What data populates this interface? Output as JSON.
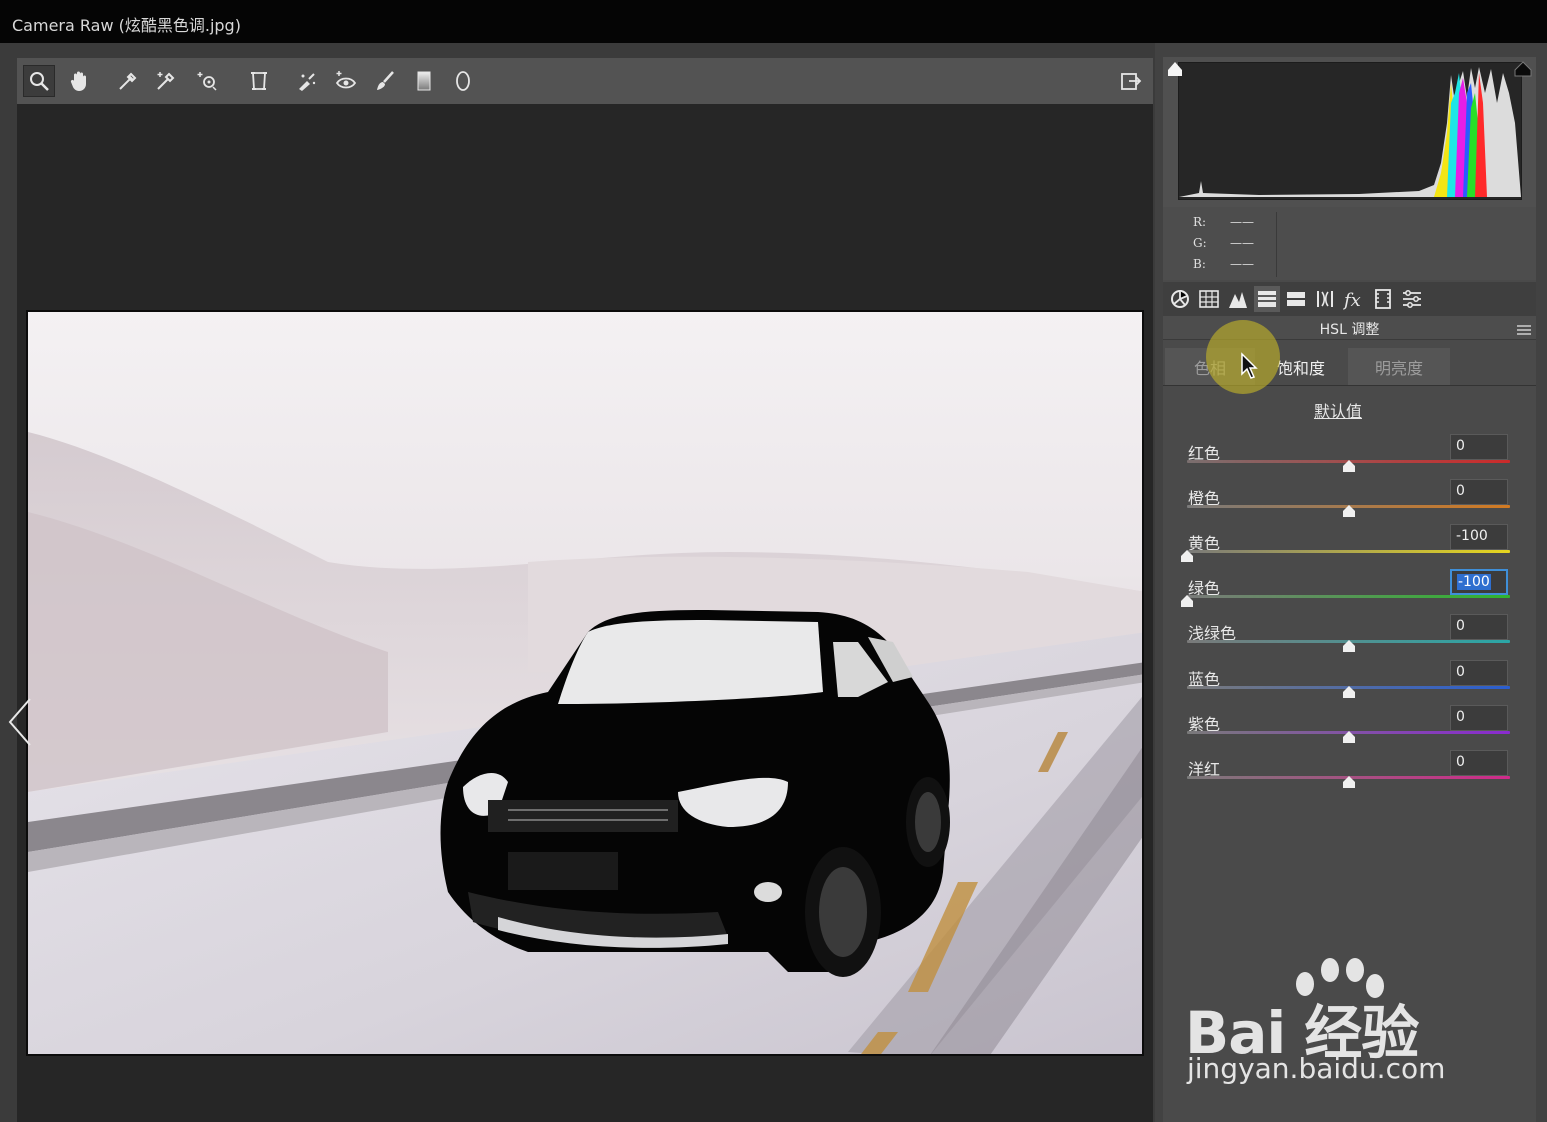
{
  "window": {
    "title": "Camera Raw (炫酷黑色调.jpg)"
  },
  "toolbar": {
    "tools": [
      "zoom-tool",
      "hand-tool",
      "white-balance-tool",
      "color-sampler-tool",
      "targeted-adjustment-tool",
      "transform-tool",
      "spot-removal-tool",
      "red-eye-tool",
      "adjustment-brush-tool",
      "graduated-filter-tool",
      "radial-filter-tool"
    ],
    "active_tool": "zoom-tool",
    "export_icon": "open-preferences-icon"
  },
  "histogram": {
    "rgb": [
      {
        "label": "R:",
        "value": "——"
      },
      {
        "label": "G:",
        "value": "——"
      },
      {
        "label": "B:",
        "value": "——"
      }
    ]
  },
  "panel_tabs": [
    "basic-icon",
    "tone-curve-icon",
    "detail-icon",
    "hsl-icon",
    "split-toning-icon",
    "lens-corrections-icon",
    "effects-icon",
    "camera-calibration-icon",
    "presets-icon"
  ],
  "hsl": {
    "section_title": "HSL 调整",
    "tabs": [
      "色相",
      "饱和度",
      "明亮度"
    ],
    "active_tab": "饱和度",
    "defaults_label": "默认值",
    "sliders": [
      {
        "label": "红色",
        "value": "0",
        "level": 0
      },
      {
        "label": "橙色",
        "value": "0",
        "level": 0
      },
      {
        "label": "黄色",
        "value": "-100",
        "level": -100
      },
      {
        "label": "绿色",
        "value": "-100",
        "level": -100
      },
      {
        "label": "浅绿色",
        "value": "0",
        "level": 0
      },
      {
        "label": "蓝色",
        "value": "0",
        "level": 0
      },
      {
        "label": "紫色",
        "value": "0",
        "level": 0
      },
      {
        "label": "洋红",
        "value": "0",
        "level": 0
      }
    ]
  },
  "watermark": {
    "brand": "Bai 经验",
    "url": "jingyan.baidu.com"
  },
  "colors": {
    "accent": "#3f8fd8",
    "panel": "#4a4a4a",
    "toolbar": "#535353"
  }
}
